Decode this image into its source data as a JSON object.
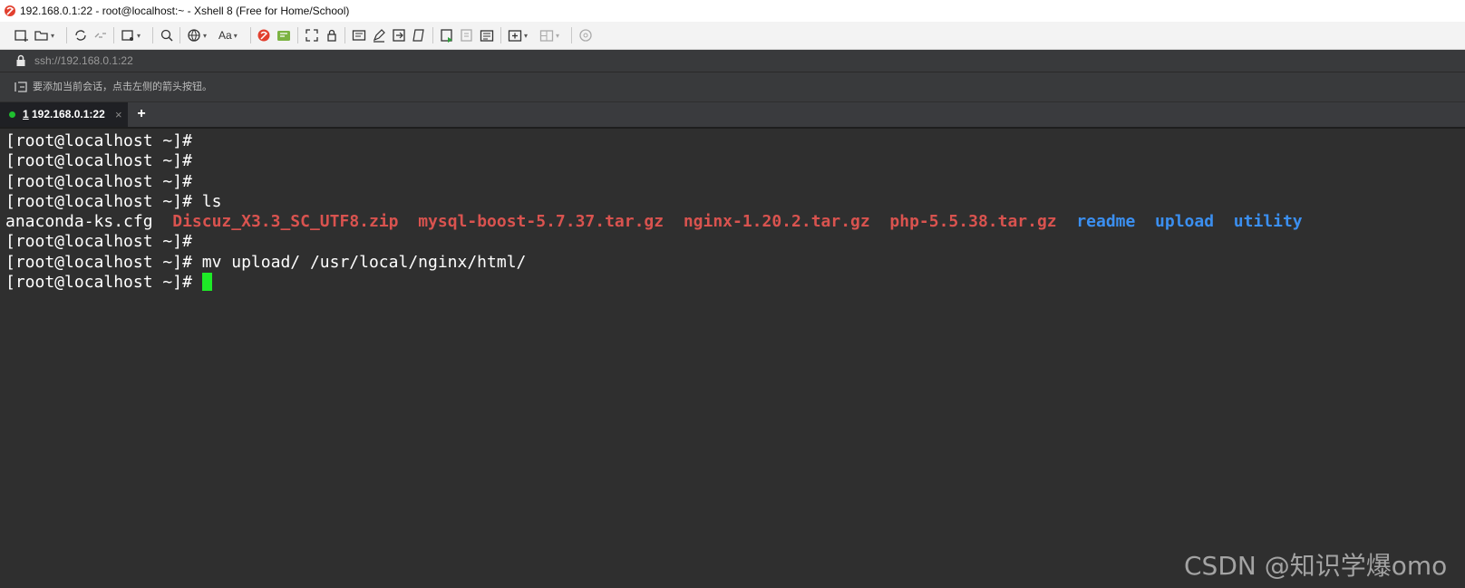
{
  "window": {
    "title": "192.168.0.1:22 - root@localhost:~ - Xshell 8 (Free for Home/School)",
    "icon": "xshell-logo-icon"
  },
  "toolbar": {
    "icons": [
      "new-session-icon",
      "open-folder-icon",
      "reconnect-icon",
      "disconnect-icon",
      "properties-icon",
      "search-icon",
      "encoding-globe-icon",
      "font-icon",
      "xftp-icon",
      "xshell-file-icon",
      "fullscreen-icon",
      "lock-icon",
      "compose-icon",
      "highlight-icon",
      "transfer-icon",
      "script-icon",
      "log-icon",
      "tunneling-icon",
      "notes-icon",
      "new-tab-icon",
      "layout-icon",
      "help-icon"
    ],
    "font_label": "Aa"
  },
  "address": {
    "value": "ssh://192.168.0.1:22"
  },
  "session_hint": {
    "text": "要添加当前会话，点击左侧的箭头按钮。"
  },
  "tabs": [
    {
      "number": "1",
      "label": "192.168.0.1:22",
      "close": "×",
      "active": true
    }
  ],
  "new_tab": "+",
  "terminal": {
    "prompt": "[root@localhost ~]#",
    "lines": [
      {
        "cmd": ""
      },
      {
        "cmd": ""
      },
      {
        "cmd": ""
      },
      {
        "cmd": " ls"
      }
    ],
    "ls_output": {
      "plain": "anaconda-ks.cfg",
      "archives": [
        "Discuz_X3.3_SC_UTF8.zip",
        "mysql-boost-5.7.37.tar.gz",
        "nginx-1.20.2.tar.gz",
        "php-5.5.38.tar.gz"
      ],
      "dirs": [
        "readme",
        "upload",
        "utility"
      ]
    },
    "after": [
      {
        "cmd": ""
      },
      {
        "cmd": " mv upload/ /usr/local/nginx/html/"
      },
      {
        "cmd": " "
      }
    ],
    "colors": {
      "archive": "#d9534f",
      "directory": "#3b8ff0",
      "cursor": "#1eea27",
      "background": "#2f2f2f"
    }
  },
  "watermark": "CSDN @知识学爆omo"
}
